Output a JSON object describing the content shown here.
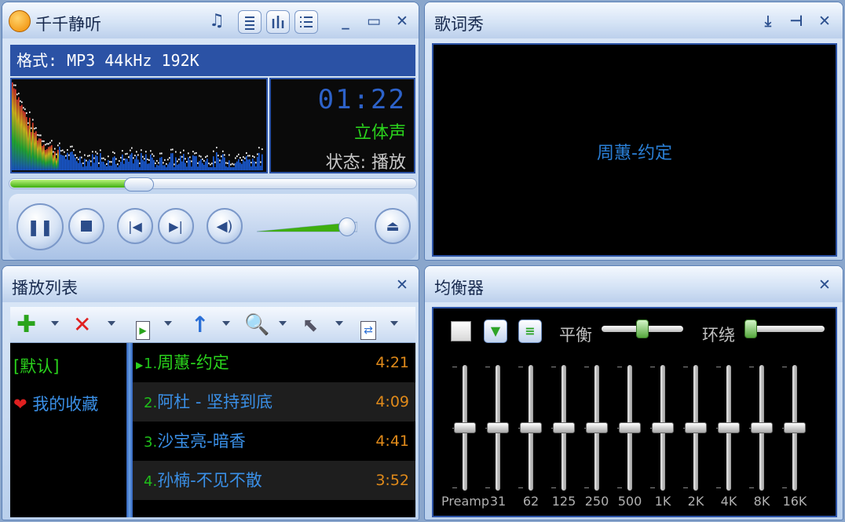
{
  "player": {
    "title": "千千静听",
    "format": "格式: MP3 44kHz 192K",
    "time": "01:22",
    "channel": "立体声",
    "status": "状态: 播放",
    "progress_fraction": 0.32,
    "volume_fraction": 0.9,
    "icons": [
      "music-note-icon",
      "lyrics-toggle-icon",
      "equalizer-toggle-icon",
      "playlist-toggle-icon",
      "minimize-icon",
      "compact-mode-icon",
      "close-icon"
    ]
  },
  "lyrics": {
    "title": "歌词秀",
    "current_line": "周蕙-约定"
  },
  "playlist": {
    "title": "播放列表",
    "groups": [
      {
        "label": "[默认]",
        "color": "#2ad21c"
      },
      {
        "label": "我的收藏",
        "color": "#3a8fe6"
      }
    ],
    "tracks": [
      {
        "num": "1.",
        "name": "周蕙-约定",
        "duration": "4:21",
        "playing": true
      },
      {
        "num": "2.",
        "name": "阿杜 - 坚持到底",
        "duration": "4:09",
        "playing": false
      },
      {
        "num": "3.",
        "name": "沙宝亮-暗香",
        "duration": "4:41",
        "playing": false
      },
      {
        "num": "4.",
        "name": "孙楠-不见不散",
        "duration": "3:52",
        "playing": false
      }
    ]
  },
  "eq": {
    "title": "均衡器",
    "balance_label": "平衡",
    "surround_label": "环绕",
    "balance_fraction": 0.5,
    "surround_fraction": 0.0,
    "bands": [
      {
        "label": "Preamp",
        "level": 0.5
      },
      {
        "label": "31",
        "level": 0.5
      },
      {
        "label": "62",
        "level": 0.5
      },
      {
        "label": "125",
        "level": 0.5
      },
      {
        "label": "250",
        "level": 0.5
      },
      {
        "label": "500",
        "level": 0.5
      },
      {
        "label": "1K",
        "level": 0.5
      },
      {
        "label": "2K",
        "level": 0.5
      },
      {
        "label": "4K",
        "level": 0.5
      },
      {
        "label": "8K",
        "level": 0.5
      },
      {
        "label": "16K",
        "level": 0.5
      }
    ]
  },
  "colors": {
    "accent": "#2b52a5",
    "green": "#2ad21c",
    "blue_text": "#3a8fe6",
    "orange_time": "#e08a1a"
  }
}
